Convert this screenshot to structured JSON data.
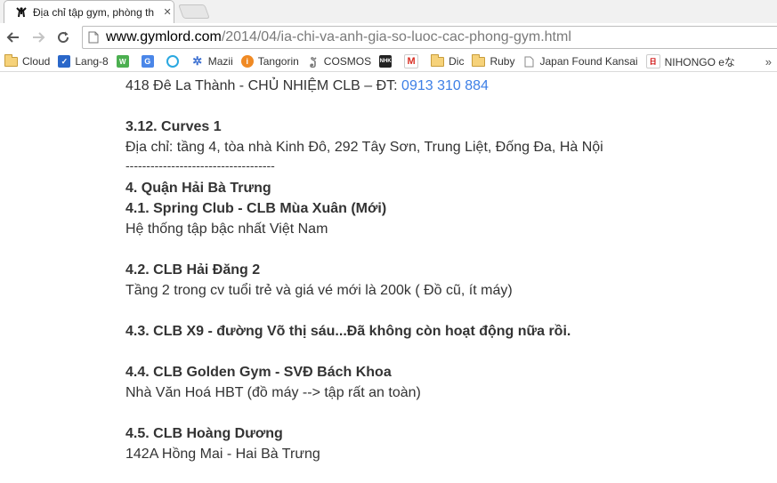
{
  "tab": {
    "title": "Địa chỉ tập gym, phòng th",
    "close": "✕"
  },
  "toolbar": {
    "url_host": "www.gymlord.com",
    "url_path": "/2014/04/ia-chi-va-anh-gia-so-luoc-cac-phong-gym.html"
  },
  "bookmarks": [
    {
      "label": "Cloud",
      "icon": "folder-icon"
    },
    {
      "label": "Lang-8",
      "icon": "checkbox-icon"
    },
    {
      "label": "",
      "icon": "wordbook-icon"
    },
    {
      "label": "",
      "icon": "translate-icon"
    },
    {
      "label": "",
      "icon": "circle-app-icon"
    },
    {
      "label": "Mazii",
      "icon": "gear-icon"
    },
    {
      "label": "Tangorin",
      "icon": "info-icon"
    },
    {
      "label": "COSMOS",
      "icon": "cosmos-icon"
    },
    {
      "label": "",
      "icon": "nhk-icon"
    },
    {
      "label": "",
      "icon": "gmail-icon"
    },
    {
      "label": "Dic",
      "icon": "folder-icon"
    },
    {
      "label": "Ruby",
      "icon": "folder-icon"
    },
    {
      "label": "Japan Found Kansai",
      "icon": "page-icon"
    },
    {
      "label": "NIHONGO eな",
      "icon": "nihongo-icon"
    }
  ],
  "content": {
    "l1_text": "418 Đê La Thành - CHỦ NHIỆM CLB – ĐT: ",
    "l1_phone": "0913 310 884",
    "s312_title": "3.12. Curves 1",
    "s312_addr": "Địa chỉ: tầng 4, tòa nhà Kinh Đô, 292 Tây Sơn, Trung Liệt, Đống Đa, Hà Nội",
    "divider": "------------------------------------",
    "s4_title": "4. Quận Hải Bà Trưng",
    "s41_title": "4.1. Spring Club - CLB Mùa Xuân (Mới)",
    "s41_desc": "Hệ thống tập bậc nhất Việt Nam",
    "s42_title": "4.2. CLB Hải Đăng 2",
    "s42_desc": "Tầng 2 trong cv tuổi trẻ và giá vé mới là 200k ( Đồ cũ, ít máy)",
    "s43_title": "4.3. CLB X9 - đường Võ thị sáu...Đã không còn hoạt động nữa rồi.",
    "s44_title": "4.4. CLB Golden Gym - SVĐ Bách Khoa",
    "s44_desc": "Nhà Văn Hoá HBT (đồ máy --> tập rất an toàn)",
    "s45_title": "4.5. CLB Hoàng Dương",
    "s45_desc": "142A Hồng Mai - Hai Bà Trưng"
  }
}
